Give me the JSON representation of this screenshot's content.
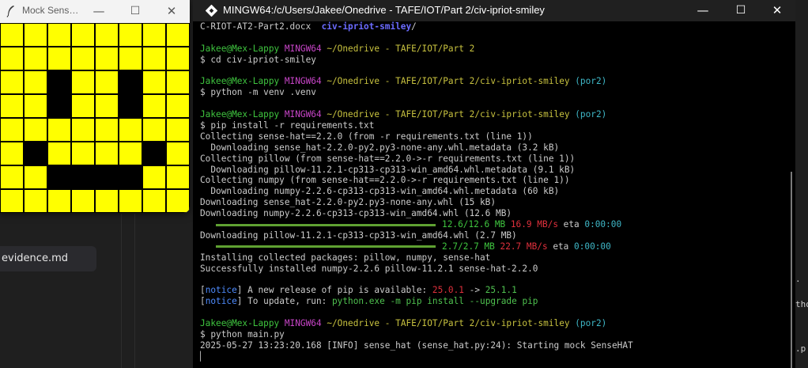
{
  "mock_window": {
    "title": "Mock Sens…",
    "led_colors": {
      "on": "#ffff00",
      "off": "#000000"
    },
    "led_matrix": [
      [
        1,
        1,
        1,
        1,
        1,
        1,
        1,
        1
      ],
      [
        1,
        1,
        1,
        1,
        1,
        1,
        1,
        1
      ],
      [
        1,
        1,
        0,
        1,
        1,
        0,
        1,
        1
      ],
      [
        1,
        1,
        0,
        1,
        1,
        0,
        1,
        1
      ],
      [
        1,
        1,
        1,
        1,
        1,
        1,
        1,
        1
      ],
      [
        1,
        0,
        1,
        1,
        1,
        1,
        0,
        1
      ],
      [
        1,
        1,
        0,
        0,
        0,
        0,
        1,
        1
      ],
      [
        1,
        1,
        1,
        1,
        1,
        1,
        1,
        1
      ]
    ]
  },
  "terminal": {
    "title": "MINGW64:/c/Users/Jakee/Onedrive - TAFE/IOT/Part 2/civ-ipriot-smiley",
    "lines": [
      {
        "segments": [
          {
            "text": "C-RIOT-AT2-Part2.docx  ",
            "color": "default"
          },
          {
            "text": "civ-ipriot-smiley",
            "color": "dir"
          },
          {
            "text": "/",
            "color": "default"
          }
        ]
      },
      {
        "segments": []
      },
      {
        "segments": [
          {
            "text": "Jakee@Mex-Lappy ",
            "color": "green"
          },
          {
            "text": "MINGW64 ",
            "color": "mag"
          },
          {
            "text": "~/Onedrive - TAFE/IOT/Part 2",
            "color": "yel"
          }
        ]
      },
      {
        "segments": [
          {
            "text": "$ cd civ-ipriot-smiley",
            "color": "default"
          }
        ]
      },
      {
        "segments": []
      },
      {
        "segments": [
          {
            "text": "Jakee@Mex-Lappy ",
            "color": "green"
          },
          {
            "text": "MINGW64 ",
            "color": "mag"
          },
          {
            "text": "~/Onedrive - TAFE/IOT/Part 2/civ-ipriot-smiley ",
            "color": "yel"
          },
          {
            "text": "(por2)",
            "color": "cyan"
          }
        ]
      },
      {
        "segments": [
          {
            "text": "$ python -m venv .venv",
            "color": "default"
          }
        ]
      },
      {
        "segments": []
      },
      {
        "segments": [
          {
            "text": "Jakee@Mex-Lappy ",
            "color": "green"
          },
          {
            "text": "MINGW64 ",
            "color": "mag"
          },
          {
            "text": "~/Onedrive - TAFE/IOT/Part 2/civ-ipriot-smiley ",
            "color": "yel"
          },
          {
            "text": "(por2)",
            "color": "cyan"
          }
        ]
      },
      {
        "segments": [
          {
            "text": "$ pip install -r requirements.txt",
            "color": "default"
          }
        ]
      },
      {
        "segments": [
          {
            "text": "Collecting sense-hat==2.2.0 (from -r requirements.txt (line 1))",
            "color": "default"
          }
        ]
      },
      {
        "segments": [
          {
            "text": "  Downloading sense_hat-2.2.0-py2.py3-none-any.whl.metadata (3.2 kB)",
            "color": "default"
          }
        ]
      },
      {
        "segments": [
          {
            "text": "Collecting pillow (from sense-hat==2.2.0->-r requirements.txt (line 1))",
            "color": "default"
          }
        ]
      },
      {
        "segments": [
          {
            "text": "  Downloading pillow-11.2.1-cp313-cp313-win_amd64.whl.metadata (9.1 kB)",
            "color": "default"
          }
        ]
      },
      {
        "segments": [
          {
            "text": "Collecting numpy (from sense-hat==2.2.0->-r requirements.txt (line 1))",
            "color": "default"
          }
        ]
      },
      {
        "segments": [
          {
            "text": "  Downloading numpy-2.2.6-cp313-cp313-win_amd64.whl.metadata (60 kB)",
            "color": "default"
          }
        ]
      },
      {
        "segments": [
          {
            "text": "Downloading sense_hat-2.2.0-py2.py3-none-any.whl (15 kB)",
            "color": "default"
          }
        ]
      },
      {
        "segments": [
          {
            "text": "Downloading numpy-2.2.6-cp313-cp313-win_amd64.whl (12.6 MB)",
            "color": "default"
          }
        ]
      },
      {
        "progress": {
          "fraction": 1.0,
          "indent": "   ",
          "size": "12.6/12.6 MB",
          "speed": "16.9 MB/s",
          "eta_label": "eta",
          "eta": "0:00:00"
        }
      },
      {
        "segments": [
          {
            "text": "Downloading pillow-11.2.1-cp313-cp313-win_amd64.whl (2.7 MB)",
            "color": "default"
          }
        ]
      },
      {
        "progress": {
          "fraction": 1.0,
          "indent": "   ",
          "size": "2.7/2.7 MB",
          "speed": "22.7 MB/s",
          "eta_label": "eta",
          "eta": "0:00:00"
        }
      },
      {
        "segments": [
          {
            "text": "Installing collected packages: pillow, numpy, sense-hat",
            "color": "default"
          }
        ]
      },
      {
        "segments": [
          {
            "text": "Successfully installed numpy-2.2.6 pillow-11.2.1 sense-hat-2.2.0",
            "color": "default"
          }
        ]
      },
      {
        "segments": []
      },
      {
        "segments": [
          {
            "text": "[",
            "color": "default"
          },
          {
            "text": "notice",
            "color": "blue"
          },
          {
            "text": "] A new release of pip is available: ",
            "color": "default"
          },
          {
            "text": "25.0.1",
            "color": "red"
          },
          {
            "text": " -> ",
            "color": "default"
          },
          {
            "text": "25.1.1",
            "color": "lgreen"
          }
        ]
      },
      {
        "segments": [
          {
            "text": "[",
            "color": "default"
          },
          {
            "text": "notice",
            "color": "blue"
          },
          {
            "text": "] To update, run: ",
            "color": "default"
          },
          {
            "text": "python.exe -m pip install --upgrade pip",
            "color": "lgreen"
          }
        ]
      },
      {
        "segments": []
      },
      {
        "segments": [
          {
            "text": "Jakee@Mex-Lappy ",
            "color": "green"
          },
          {
            "text": "MINGW64 ",
            "color": "mag"
          },
          {
            "text": "~/Onedrive - TAFE/IOT/Part 2/civ-ipriot-smiley ",
            "color": "yel"
          },
          {
            "text": "(por2)",
            "color": "cyan"
          }
        ]
      },
      {
        "segments": [
          {
            "text": "$ python main.py",
            "color": "default"
          }
        ]
      },
      {
        "segments": [
          {
            "text": "2025-05-27 13:23:20.168 [INFO] sense_hat (sense_hat.py:24): Starting mock SenseHAT",
            "color": "default"
          }
        ]
      },
      {
        "segments": [
          {
            "text": "▏",
            "color": "default"
          }
        ]
      }
    ]
  },
  "background_editor": {
    "file_tab_label": "evidence.md",
    "right_fragments": [
      ".",
      "tho",
      ".p"
    ]
  }
}
